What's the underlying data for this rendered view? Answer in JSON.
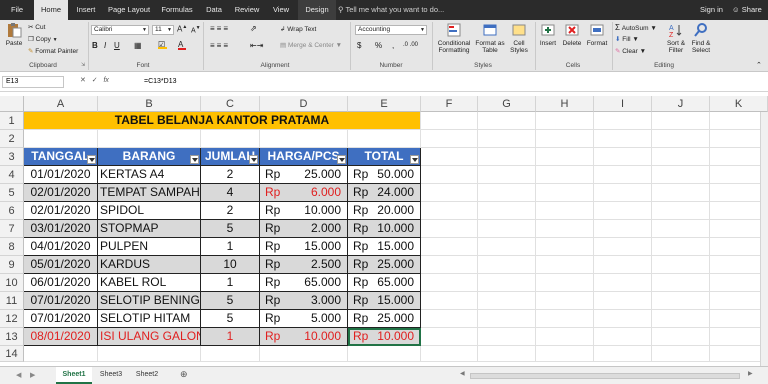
{
  "ribbon_tabs": [
    "File",
    "Home",
    "Insert",
    "Page Layout",
    "Formulas",
    "Data",
    "Review",
    "View",
    "Design"
  ],
  "tell_me": "Tell me what you want to do...",
  "sign_in": "Sign in",
  "share": "Share",
  "clipboard": {
    "paste": "Paste",
    "cut": "Cut",
    "copy": "Copy",
    "format_painter": "Format Painter",
    "label": "Clipboard"
  },
  "font": {
    "name": "Calibri",
    "size": "11",
    "label": "Font"
  },
  "alignment": {
    "wrap_text": "Wrap Text",
    "merge_center": "Merge & Center",
    "label": "Alignment"
  },
  "number": {
    "format": "Accounting",
    "currency": "$",
    "percent": "%",
    "comma": ",",
    "label": "Number"
  },
  "styles": {
    "conditional": "Conditional Formatting",
    "format_table": "Format as Table",
    "cell_styles": "Cell Styles",
    "label": "Styles"
  },
  "cells": {
    "insert": "Insert",
    "delete": "Delete",
    "format": "Format",
    "label": "Cells"
  },
  "editing": {
    "autosum": "AutoSum",
    "fill": "Fill",
    "clear": "Clear",
    "sort_filter": "Sort & Filter",
    "find_select": "Find & Select",
    "label": "Editing"
  },
  "name_box": "E13",
  "formula": "=C13*D13",
  "columns": [
    "A",
    "B",
    "C",
    "D",
    "E",
    "F",
    "G",
    "H",
    "I",
    "J",
    "K"
  ],
  "rows": [
    "1",
    "2",
    "3",
    "4",
    "5",
    "6",
    "7",
    "8",
    "9",
    "10",
    "11",
    "12",
    "13",
    "14"
  ],
  "sheet": {
    "title": "TABEL BELANJA KANTOR PRATAMA",
    "headers": [
      "TANGGAL",
      "BARANG",
      "JUMLAH",
      "HARGA/PCS",
      "TOTAL"
    ],
    "currency": "Rp",
    "records": [
      {
        "tanggal": "01/01/2020",
        "barang": "KERTAS A4",
        "jumlah": "2",
        "harga": "25.000",
        "total": "50.000"
      },
      {
        "tanggal": "02/01/2020",
        "barang": "TEMPAT SAMPAH",
        "jumlah": "4",
        "harga": "6.000",
        "total": "24.000"
      },
      {
        "tanggal": "02/01/2020",
        "barang": "SPIDOL",
        "jumlah": "2",
        "harga": "10.000",
        "total": "20.000"
      },
      {
        "tanggal": "03/01/2020",
        "barang": "STOPMAP",
        "jumlah": "5",
        "harga": "2.000",
        "total": "10.000"
      },
      {
        "tanggal": "04/01/2020",
        "barang": "PULPEN",
        "jumlah": "1",
        "harga": "15.000",
        "total": "15.000"
      },
      {
        "tanggal": "05/01/2020",
        "barang": "KARDUS",
        "jumlah": "10",
        "harga": "2.500",
        "total": "25.000"
      },
      {
        "tanggal": "06/01/2020",
        "barang": "KABEL ROL",
        "jumlah": "1",
        "harga": "65.000",
        "total": "65.000"
      },
      {
        "tanggal": "07/01/2020",
        "barang": "SELOTIP BENING",
        "jumlah": "5",
        "harga": "3.000",
        "total": "15.000"
      },
      {
        "tanggal": "07/01/2020",
        "barang": "SELOTIP HITAM",
        "jumlah": "5",
        "harga": "5.000",
        "total": "25.000"
      },
      {
        "tanggal": "08/01/2020",
        "barang": "ISI ULANG GALON",
        "jumlah": "1",
        "harga": "10.000",
        "total": "10.000"
      }
    ]
  },
  "sheet_tabs": [
    "Sheet1",
    "Sheet3",
    "Sheet2"
  ],
  "colors": {
    "header_blue": "#3f6fc1",
    "title_yellow": "#ffc000",
    "band_gray": "#d9d9d9",
    "red_text": "#e02020",
    "excel_green": "#217346"
  }
}
